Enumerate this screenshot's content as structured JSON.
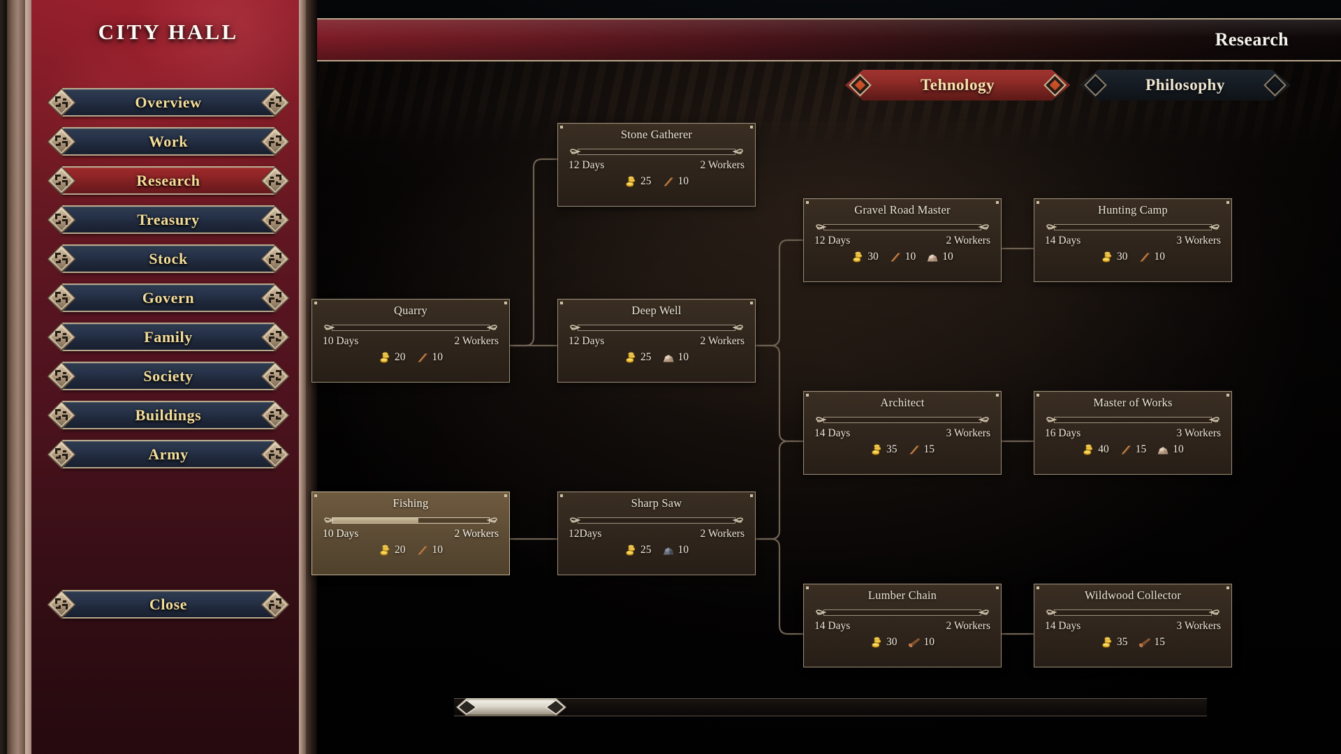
{
  "header": {
    "title": "Research"
  },
  "sidebar": {
    "title": "CITY HALL",
    "items": [
      {
        "label": "Overview",
        "active": false
      },
      {
        "label": "Work",
        "active": false
      },
      {
        "label": "Research",
        "active": true
      },
      {
        "label": "Treasury",
        "active": false
      },
      {
        "label": "Stock",
        "active": false
      },
      {
        "label": "Govern",
        "active": false
      },
      {
        "label": "Family",
        "active": false
      },
      {
        "label": "Society",
        "active": false
      },
      {
        "label": "Buildings",
        "active": false
      },
      {
        "label": "Army",
        "active": false
      }
    ],
    "close_label": "Close"
  },
  "tabs": [
    {
      "label": "Tehnology",
      "active": true
    },
    {
      "label": "Philosophy",
      "active": false
    }
  ],
  "colors": {
    "accent_red": "#8e2b27",
    "gold_text": "#f4dd9a",
    "frame_tan": "#b8a88c",
    "node_bg": "#352a20",
    "node_inprogress_bg": "#66533a",
    "panel_red": "#7e1c27"
  },
  "scrollbar": {
    "orientation": "horizontal",
    "thumb_position_pct": 2,
    "thumb_width_pct": 15
  },
  "research_nodes": [
    {
      "id": "stone-gatherer",
      "name": "Stone Gatherer",
      "days": "12 Days",
      "workers": "2 Workers",
      "progress": 0,
      "state": "available",
      "costs": [
        {
          "icon": "gold-coins-icon",
          "amount": "25"
        },
        {
          "icon": "wood-plank-icon",
          "amount": "10"
        }
      ]
    },
    {
      "id": "quarry",
      "name": "Quarry",
      "days": "10 Days",
      "workers": "2 Workers",
      "progress": 0,
      "state": "available",
      "costs": [
        {
          "icon": "gold-coins-icon",
          "amount": "20"
        },
        {
          "icon": "wood-plank-icon",
          "amount": "10"
        }
      ]
    },
    {
      "id": "deep-well",
      "name": "Deep Well",
      "days": "12 Days",
      "workers": "2 Workers",
      "progress": 0,
      "state": "available",
      "costs": [
        {
          "icon": "gold-coins-icon",
          "amount": "25"
        },
        {
          "icon": "stone-icon",
          "amount": "10"
        }
      ]
    },
    {
      "id": "gravel-road-master",
      "name": "Gravel Road Master",
      "days": "12 Days",
      "workers": "2 Workers",
      "progress": 0,
      "state": "available",
      "costs": [
        {
          "icon": "gold-coins-icon",
          "amount": "30"
        },
        {
          "icon": "wood-plank-icon",
          "amount": "10"
        },
        {
          "icon": "stone-icon",
          "amount": "10"
        }
      ]
    },
    {
      "id": "hunting-camp",
      "name": "Hunting Camp",
      "days": "14 Days",
      "workers": "3 Workers",
      "progress": 0,
      "state": "available",
      "costs": [
        {
          "icon": "gold-coins-icon",
          "amount": "30"
        },
        {
          "icon": "wood-plank-icon",
          "amount": "10"
        }
      ]
    },
    {
      "id": "architect",
      "name": "Architect",
      "days": "14 Days",
      "workers": "3 Workers",
      "progress": 0,
      "state": "available",
      "costs": [
        {
          "icon": "gold-coins-icon",
          "amount": "35"
        },
        {
          "icon": "wood-plank-icon",
          "amount": "15"
        }
      ]
    },
    {
      "id": "master-of-works",
      "name": "Master of Works",
      "days": "16 Days",
      "workers": "3 Workers",
      "progress": 0,
      "state": "available",
      "costs": [
        {
          "icon": "gold-coins-icon",
          "amount": "40"
        },
        {
          "icon": "wood-plank-icon",
          "amount": "15"
        },
        {
          "icon": "stone-icon",
          "amount": "10"
        }
      ]
    },
    {
      "id": "fishing",
      "name": "Fishing",
      "days": "10 Days",
      "workers": "2 Workers",
      "progress": 55,
      "state": "in-progress",
      "costs": [
        {
          "icon": "gold-coins-icon",
          "amount": "20"
        },
        {
          "icon": "wood-plank-icon",
          "amount": "10"
        }
      ]
    },
    {
      "id": "sharp-saw",
      "name": "Sharp Saw",
      "days": "12Days",
      "workers": "2 Workers",
      "progress": 0,
      "state": "available",
      "costs": [
        {
          "icon": "gold-coins-icon",
          "amount": "25"
        },
        {
          "icon": "iron-ore-icon",
          "amount": "10"
        }
      ]
    },
    {
      "id": "lumber-chain",
      "name": "Lumber Chain",
      "days": "14 Days",
      "workers": "2 Workers",
      "progress": 0,
      "state": "available",
      "costs": [
        {
          "icon": "gold-coins-icon",
          "amount": "30"
        },
        {
          "icon": "log-icon",
          "amount": "10"
        }
      ]
    },
    {
      "id": "wildwood-collector",
      "name": "Wildwood Collector",
      "days": "14 Days",
      "workers": "3 Workers",
      "progress": 0,
      "state": "available",
      "costs": [
        {
          "icon": "gold-coins-icon",
          "amount": "35"
        },
        {
          "icon": "log-icon",
          "amount": "15"
        }
      ]
    }
  ]
}
